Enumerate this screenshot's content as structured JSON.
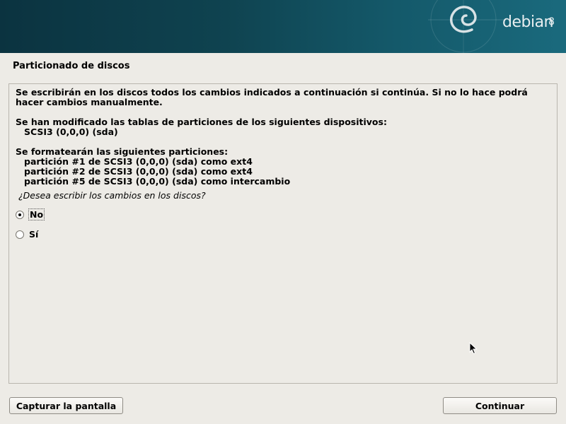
{
  "banner": {
    "logo_text": "debian",
    "logo_version": "8"
  },
  "page": {
    "title": "Particionado de discos"
  },
  "message": {
    "intro": "Se escribirán en los discos todos los cambios indicados a continuación si continúa. Si no lo hace podrá hacer cambios manualmente.",
    "modified_heading": "Se han modificado las tablas de particiones de los siguientes dispositivos:",
    "modified_devices": [
      "SCSI3 (0,0,0) (sda)"
    ],
    "format_heading": "Se formatearán las siguientes particiones:",
    "format_partitions": [
      "partición #1 de SCSI3 (0,0,0) (sda) como ext4",
      "partición #2 de SCSI3 (0,0,0) (sda) como ext4",
      "partición #5 de SCSI3 (0,0,0) (sda) como intercambio"
    ]
  },
  "question": "¿Desea escribir los cambios en los discos?",
  "options": [
    {
      "label": "No",
      "selected": true
    },
    {
      "label": "Sí",
      "selected": false
    }
  ],
  "buttons": {
    "screenshot": "Capturar la pantalla",
    "continue": "Continuar"
  }
}
